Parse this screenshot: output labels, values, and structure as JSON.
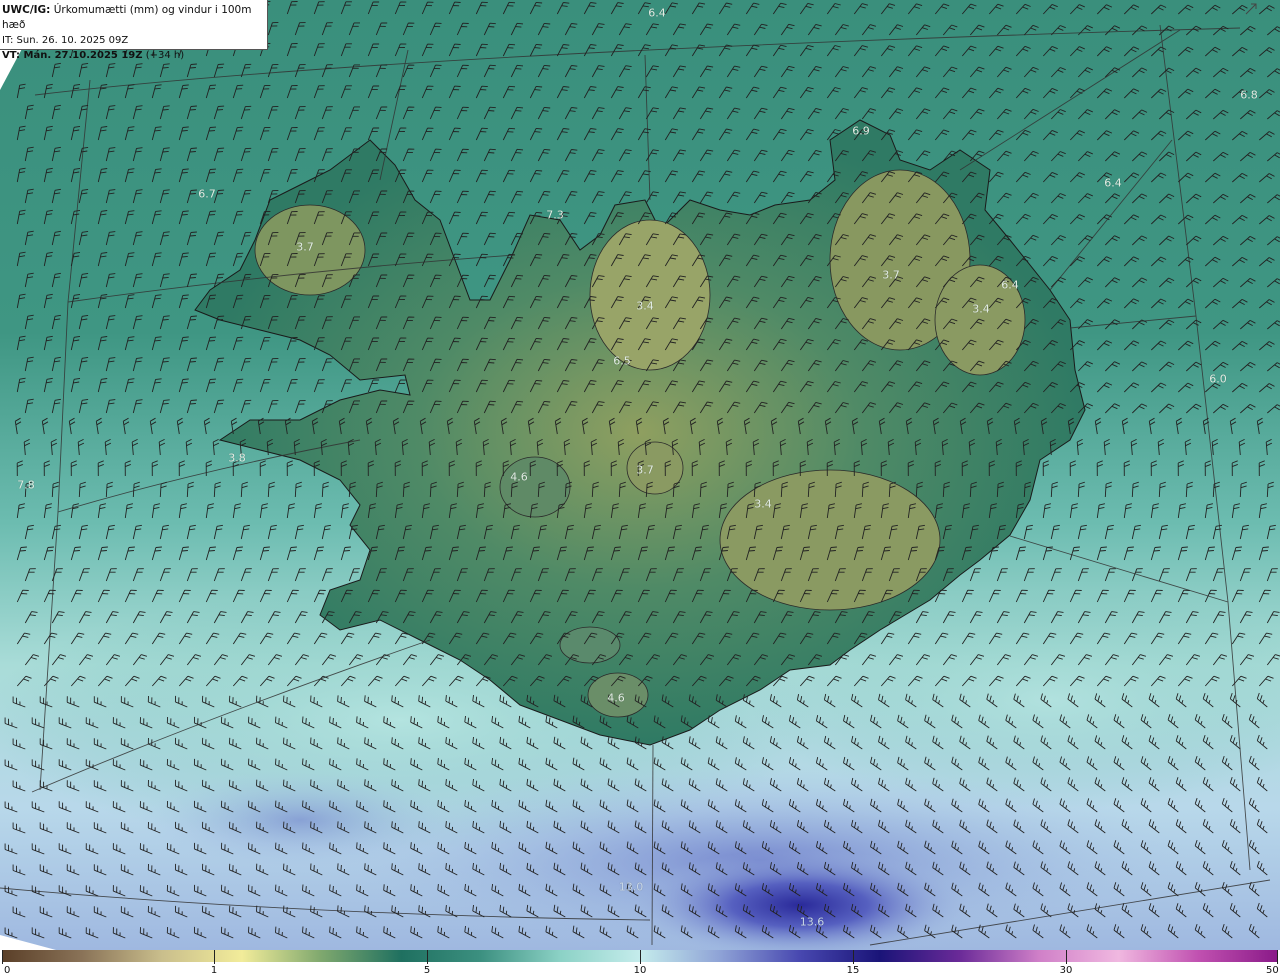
{
  "header": {
    "product": "UWC/IG:",
    "description": "Úrkomumætti (mm) og vindur i 100m hæð",
    "initial_time": "IT: Sun. 26. 10. 2025 09Z",
    "valid_prefix": "VT: Mán. 27.10.2025 19Z",
    "valid_suffix": "(+34 h)"
  },
  "value_labels": [
    "6.4",
    "6.8",
    "6.9",
    "6.4",
    "6.7",
    "7.3",
    "3.7",
    "3.7",
    "6.4",
    "3.4",
    "3.4",
    "6.5",
    "6.0",
    "3.8",
    "7.8",
    "4.6",
    "3.7",
    "3.4",
    "4.6",
    "13.0",
    "13.6"
  ],
  "colorbar": {
    "ticks": [
      "0",
      "1",
      "5",
      "10",
      "15",
      "30",
      "50"
    ],
    "colors": [
      "#5a3f28",
      "#8a7358",
      "#c9be8c",
      "#f2ec9a",
      "#7fa86e",
      "#1f7060",
      "#3c9080",
      "#8cd2c6",
      "#c5ecec",
      "#8ea2d6",
      "#4848b0",
      "#1a1478",
      "#6a2a98",
      "#d080c8",
      "#f0b8e0",
      "#c050b0",
      "#8a1a88"
    ]
  }
}
